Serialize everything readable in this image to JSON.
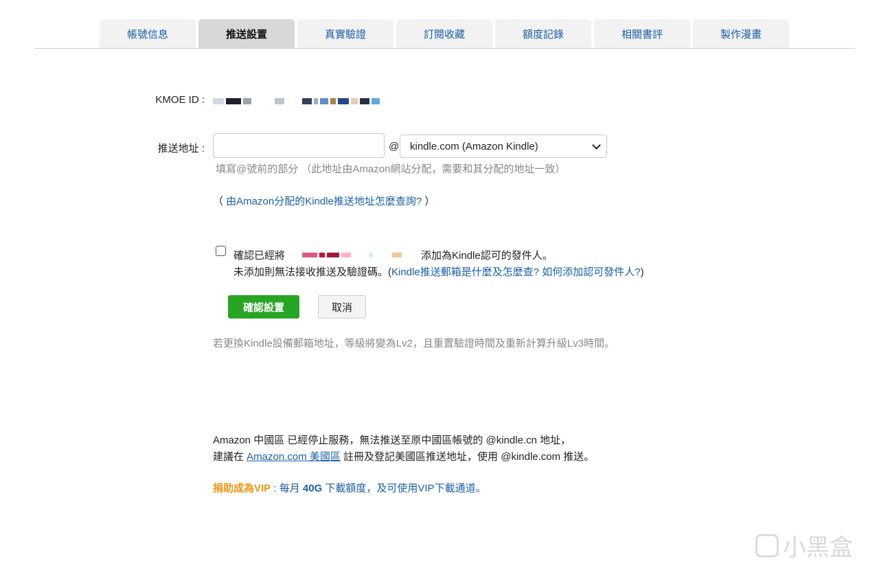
{
  "tabs": [
    {
      "label": "帳號信息",
      "active": false
    },
    {
      "label": "推送設置",
      "active": true
    },
    {
      "label": "真實驗證",
      "active": false
    },
    {
      "label": "訂閱收藏",
      "active": false
    },
    {
      "label": "額度記錄",
      "active": false
    },
    {
      "label": "相關書評",
      "active": false
    },
    {
      "label": "製作漫畫",
      "active": false
    }
  ],
  "form": {
    "kmoe_id_label": "KMOE ID :",
    "push_label": "推送地址 :",
    "email_value": "",
    "at_sign": "@",
    "domain_selected": "kindle.com (Amazon Kindle)",
    "hint": "填寫@號前的部分 （此地址由Amazon網站分配，需要和其分配的地址一致）",
    "help_open": "（ ",
    "help_link": "由Amazon分配的Kindle推送地址怎麼查詢?",
    "help_close": " ）",
    "confirm_prefix": "確認已經將",
    "confirm_suffix": "添加為Kindle認可的發件人。",
    "confirm_line2_text": "未添加則無法接收推送及驗證碼。(",
    "confirm_link": "Kindle推送郵箱是什麼及怎麼查? 如何添加認可發件人?",
    "confirm_line2_close": ")",
    "confirm_button": "確認設置",
    "cancel_button": "取消",
    "warning": "若更換Kindle設備郵箱地址，等級將變為Lv2，且重置驗證時間及重新計算升級Lv3時間。"
  },
  "notice": {
    "line1": "Amazon 中國區 已經停止服務，無法推送至原中國區帳號的 @kindle.cn 地址，",
    "line2_prefix": "建議在 ",
    "line2_link": "Amazon.com 美國區",
    "line2_suffix": " 註冊及登記美國區推送地址，使用 @kindle.com 推送。",
    "vip_label": "捐助成為VIP",
    "vip_sep": " : 每月 ",
    "vip_amount": "40G",
    "vip_text": " 下載額度，及可使用VIP下載通道。"
  },
  "watermark": "小黑盒",
  "colors": {
    "primary": "#27a524",
    "link": "#1a5fa8",
    "vip": "#f0950c"
  }
}
